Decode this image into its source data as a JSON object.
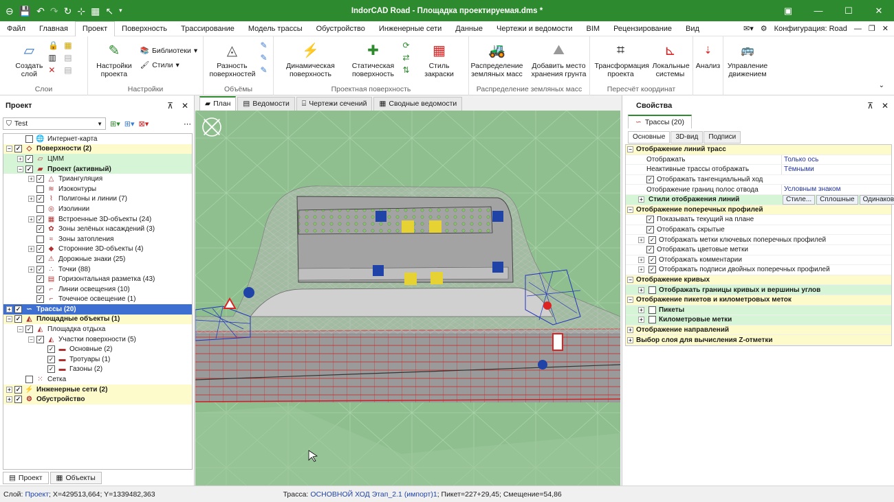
{
  "window": {
    "title": "IndorCAD Road - Площадка проектируемая.dms *"
  },
  "menu": {
    "items": [
      "Файл",
      "Главная",
      "Проект",
      "Поверхность",
      "Трассирование",
      "Модель трассы",
      "Обустройство",
      "Инженерные сети",
      "Данные",
      "Чертежи и ведомости",
      "BIM",
      "Рецензирование",
      "Вид"
    ],
    "active": "Проект",
    "config_label": "Конфигурация: Road"
  },
  "ribbon": {
    "groups": [
      {
        "label": "Слои",
        "buttons": [
          "Создать слой"
        ]
      },
      {
        "label": "Настройки",
        "buttons": [
          "Настройки проекта"
        ],
        "small": [
          "Библиотеки",
          "Стили"
        ]
      },
      {
        "label": "Объёмы",
        "buttons": [
          "Разность поверхностей"
        ]
      },
      {
        "label": "Проектная поверхность",
        "buttons": [
          "Динамическая поверхность",
          "Статическая поверхность",
          "Стиль закраски"
        ]
      },
      {
        "label": "Распределение земляных масс",
        "buttons": [
          "Распределение земляных масс",
          "Добавить место хранения грунта"
        ]
      },
      {
        "label": "Пересчёт координат",
        "buttons": [
          "Трансформация проекта",
          "Локальные системы"
        ]
      },
      {
        "label": "",
        "buttons": [
          "Анализ"
        ]
      },
      {
        "label": "",
        "buttons": [
          "Управление движением"
        ]
      }
    ]
  },
  "project_panel": {
    "title": "Проект",
    "combo_value": "Test",
    "tree": [
      {
        "label": "Интернет-карта",
        "level": 1,
        "exp": "none",
        "checked": false,
        "icon": "globe-icon",
        "glyph": "🌐",
        "style": ""
      },
      {
        "label": "Поверхности (2)",
        "level": 0,
        "exp": "-",
        "checked": true,
        "icon": "surfaces-icon",
        "glyph": "◇",
        "style": "bold hl-y"
      },
      {
        "label": "ЦММ",
        "level": 1,
        "exp": "+",
        "checked": true,
        "icon": "surface-icon",
        "glyph": "▱",
        "style": "hl-g"
      },
      {
        "label": "Проект (активный)",
        "level": 1,
        "exp": "-",
        "checked": true,
        "icon": "surface-active-icon",
        "glyph": "▰",
        "style": "bold hl-g"
      },
      {
        "label": "Триангуляция",
        "level": 2,
        "exp": "+",
        "checked": true,
        "icon": "triangulation-icon",
        "glyph": "△",
        "style": ""
      },
      {
        "label": "Изоконтуры",
        "level": 2,
        "exp": "none",
        "checked": false,
        "icon": "isocontour-icon",
        "glyph": "≋",
        "style": ""
      },
      {
        "label": "Полигоны и линии (7)",
        "level": 2,
        "exp": "+",
        "checked": true,
        "icon": "polygon-icon",
        "glyph": "⌇",
        "style": ""
      },
      {
        "label": "Изолинии",
        "level": 2,
        "exp": "none",
        "checked": false,
        "icon": "isoline-icon",
        "glyph": "◎",
        "style": ""
      },
      {
        "label": "Встроенные 3D-объекты (24)",
        "level": 2,
        "exp": "+",
        "checked": true,
        "icon": "object3d-icon",
        "glyph": "▦",
        "style": ""
      },
      {
        "label": "Зоны зелёных насаждений (3)",
        "level": 2,
        "exp": "none",
        "checked": true,
        "icon": "green-zone-icon",
        "glyph": "✿",
        "style": ""
      },
      {
        "label": "Зоны затопления",
        "level": 2,
        "exp": "none",
        "checked": false,
        "icon": "flood-zone-icon",
        "glyph": "≈",
        "style": ""
      },
      {
        "label": "Сторонние 3D-объекты (4)",
        "level": 2,
        "exp": "+",
        "checked": true,
        "icon": "external-object-icon",
        "glyph": "◆",
        "style": ""
      },
      {
        "label": "Дорожные знаки (25)",
        "level": 2,
        "exp": "none",
        "checked": true,
        "icon": "road-sign-icon",
        "glyph": "⚠",
        "style": ""
      },
      {
        "label": "Точки (88)",
        "level": 2,
        "exp": "+",
        "checked": true,
        "icon": "point-icon",
        "glyph": "∴",
        "style": ""
      },
      {
        "label": "Горизонтальная разметка (43)",
        "level": 2,
        "exp": "none",
        "checked": true,
        "icon": "marking-icon",
        "glyph": "▤",
        "style": ""
      },
      {
        "label": "Линии освещения (10)",
        "level": 2,
        "exp": "none",
        "checked": true,
        "icon": "lighting-line-icon",
        "glyph": "⌐",
        "style": ""
      },
      {
        "label": "Точечное освещение (1)",
        "level": 2,
        "exp": "none",
        "checked": true,
        "icon": "lamp-icon",
        "glyph": "⌐",
        "style": ""
      },
      {
        "label": "Трассы (20)",
        "level": 0,
        "exp": "+",
        "checked": true,
        "icon": "route-icon",
        "glyph": "∽",
        "style": "bold sel"
      },
      {
        "label": "Площадные объекты (1)",
        "level": 0,
        "exp": "-",
        "checked": true,
        "icon": "area-object-icon",
        "glyph": "◭",
        "style": "bold hl-y"
      },
      {
        "label": "Площадка отдыха",
        "level": 1,
        "exp": "-",
        "checked": true,
        "icon": "area-icon",
        "glyph": "◭",
        "style": ""
      },
      {
        "label": "Участки поверхности (5)",
        "level": 2,
        "exp": "-",
        "checked": true,
        "icon": "surface-section-icon",
        "glyph": "◭",
        "style": ""
      },
      {
        "label": "Основные (2)",
        "level": 3,
        "exp": "none",
        "checked": true,
        "icon": "folder-icon",
        "glyph": "▬",
        "style": ""
      },
      {
        "label": "Тротуары (1)",
        "level": 3,
        "exp": "none",
        "checked": true,
        "icon": "folder-icon",
        "glyph": "▬",
        "style": ""
      },
      {
        "label": "Газоны (2)",
        "level": 3,
        "exp": "none",
        "checked": true,
        "icon": "folder-icon",
        "glyph": "▬",
        "style": ""
      },
      {
        "label": "Сетка",
        "level": 1,
        "exp": "none",
        "checked": false,
        "icon": "grid-icon",
        "glyph": "⁙",
        "style": ""
      },
      {
        "label": "Инженерные сети (2)",
        "level": 0,
        "exp": "+",
        "checked": true,
        "icon": "network-icon",
        "glyph": "⚡",
        "style": "bold hl-y"
      },
      {
        "label": "Обустройство",
        "level": 0,
        "exp": "+",
        "checked": true,
        "icon": "equipment-icon",
        "glyph": "⚙",
        "style": "bold hl-y"
      }
    ],
    "bottom_tabs": [
      "Проект",
      "Объекты"
    ]
  },
  "doc_tabs": [
    "План",
    "Ведомости",
    "Чертежи сечений",
    "Сводные ведомости"
  ],
  "properties_panel": {
    "title": "Свойства",
    "object_tab": "Трассы (20)",
    "subtabs": [
      "Основные",
      "3D-вид",
      "Подписи"
    ],
    "rows": [
      {
        "type": "cat",
        "label": "Отображение линий трасс",
        "exp": "-"
      },
      {
        "type": "prop",
        "label": "Отображать",
        "value": "Только ось"
      },
      {
        "type": "prop",
        "label": "Неактивные трассы отображать",
        "value": "Тёмными"
      },
      {
        "type": "check",
        "label": "Отображать тангенциальный ход",
        "checked": true
      },
      {
        "type": "prop",
        "label": "Отображение границ полос отвода",
        "value": "Условным знаком"
      },
      {
        "type": "gcat",
        "label": "Стили отображения линий",
        "exp": "+",
        "buttons": [
          "Стиле...",
          "Сплошные",
          "Одинаковые"
        ]
      },
      {
        "type": "cat",
        "label": "Отображение поперечных профилей",
        "exp": "-"
      },
      {
        "type": "check",
        "label": "Показывать текущий на плане",
        "checked": true
      },
      {
        "type": "check",
        "label": "Отображать скрытые",
        "checked": true
      },
      {
        "type": "check",
        "label": "Отображать метки ключевых поперечных профилей",
        "checked": true,
        "exp": "+"
      },
      {
        "type": "check",
        "label": "Отображать цветовые метки",
        "checked": true
      },
      {
        "type": "check",
        "label": "Отображать комментарии",
        "checked": true,
        "exp": "+"
      },
      {
        "type": "check",
        "label": "Отображать подписи двойных поперечных профилей",
        "checked": true,
        "exp": "+"
      },
      {
        "type": "cat",
        "label": "Отображение кривых",
        "exp": "-"
      },
      {
        "type": "gcheck",
        "label": "Отображать границы кривых и вершины углов",
        "checked": false,
        "exp": "+"
      },
      {
        "type": "cat",
        "label": "Отображение пикетов и километровых меток",
        "exp": "-"
      },
      {
        "type": "gcheck",
        "label": "Пикеты",
        "checked": false,
        "exp": "+"
      },
      {
        "type": "gcheck",
        "label": "Километровые метки",
        "checked": false,
        "exp": "+"
      },
      {
        "type": "cat",
        "label": "Отображение направлений",
        "exp": "+"
      },
      {
        "type": "cat",
        "label": "Выбор слоя для вычисления Z-отметки",
        "exp": "+"
      }
    ]
  },
  "status": {
    "layer_label": "Слой:",
    "layer_value": "Проект",
    "coords": "; X=429513,664; Y=1339482,363",
    "route_label": "Трасса:",
    "route_value": "ОСНОВНОЙ ХОД Этап_2.1 (импорт)1",
    "picket": "; Пикет=227+29,45; Смещение=54,86"
  },
  "colors": {
    "accent": "#2e8a2e",
    "selection": "#3c6fd1",
    "category": "#fdfbcc",
    "subcategory": "#d6f5d6",
    "map_bg": "#8fbf8f"
  }
}
